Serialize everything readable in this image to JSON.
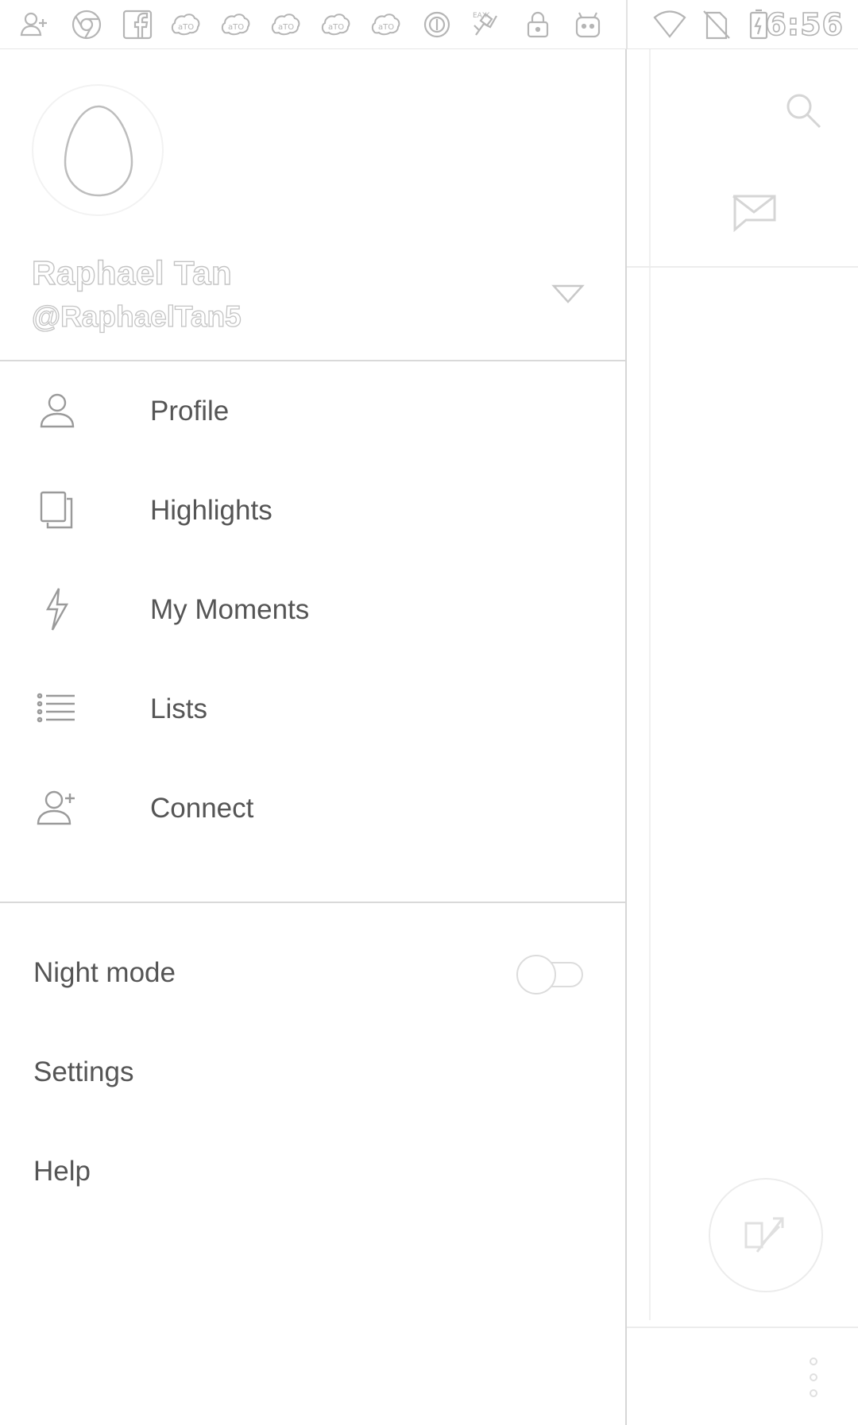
{
  "status_bar": {
    "time": "6:56",
    "left_icons": [
      "add-friend-icon",
      "chrome-icon",
      "facebook-icon",
      "app-notification-icon",
      "app-notification-icon",
      "app-notification-icon",
      "app-notification-icon",
      "app-notification-icon",
      "circle-app-icon",
      "shuttle-icon",
      "lock-icon",
      "android-icon"
    ],
    "right_icons": [
      "wifi-icon",
      "no-sim-icon",
      "battery-charging-icon"
    ]
  },
  "drawer": {
    "header": {
      "display_name": "Raphael Tan",
      "handle": "@RaphaelTan5"
    },
    "menu": [
      {
        "label": "Profile",
        "icon": "profile-icon"
      },
      {
        "label": "Highlights",
        "icon": "highlights-icon"
      },
      {
        "label": "My Moments",
        "icon": "lightning-icon"
      },
      {
        "label": "Lists",
        "icon": "list-icon"
      },
      {
        "label": "Connect",
        "icon": "connect-icon"
      }
    ],
    "settings": [
      {
        "label": "Night mode",
        "toggle": false
      },
      {
        "label": "Settings"
      },
      {
        "label": "Help"
      }
    ]
  },
  "background_app": {
    "icons": [
      "search-icon",
      "mail-icon",
      "compose-icon",
      "more-icon"
    ]
  },
  "colors": {
    "text": "#555555",
    "outline": "#c4c4c4",
    "divider": "#d9d9d9",
    "background": "#ffffff"
  }
}
